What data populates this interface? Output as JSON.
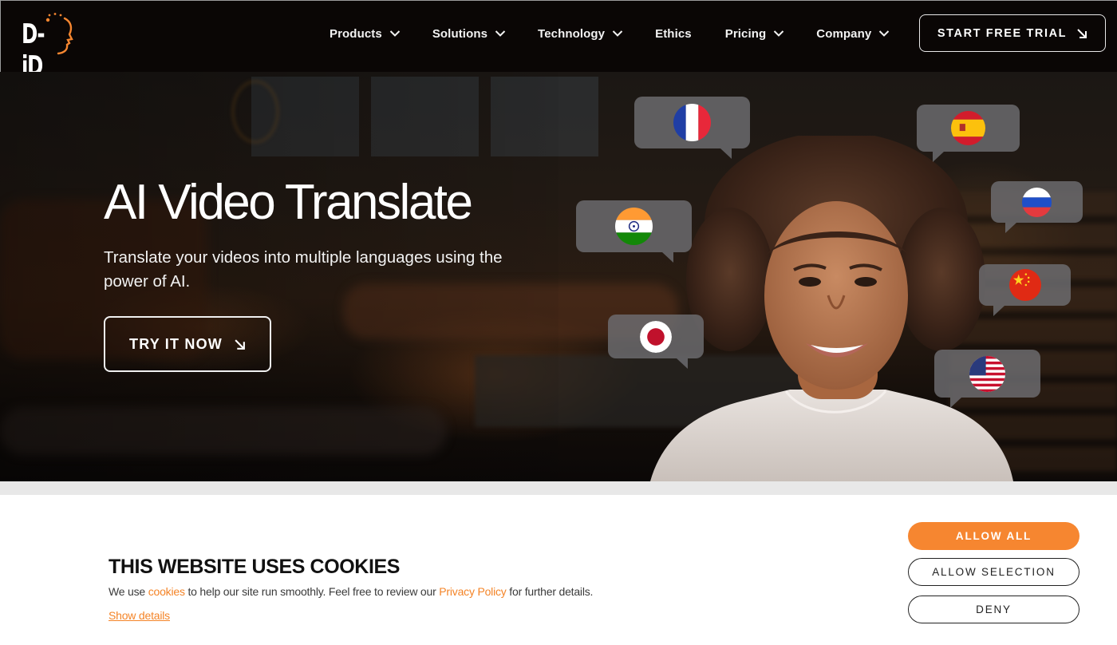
{
  "nav": {
    "logo_text": "D-iD",
    "items": [
      {
        "label": "Products",
        "has_dropdown": true
      },
      {
        "label": "Solutions",
        "has_dropdown": true
      },
      {
        "label": "Technology",
        "has_dropdown": true
      },
      {
        "label": "Ethics",
        "has_dropdown": false
      },
      {
        "label": "Pricing",
        "has_dropdown": true
      },
      {
        "label": "Company",
        "has_dropdown": true
      }
    ],
    "cta_label": "START FREE TRIAL",
    "cta_icon": "arrow-down-right-icon"
  },
  "hero": {
    "title": "AI Video Translate",
    "subtitle": "Translate your videos into multiple languages using the power of AI.",
    "cta_label": "TRY IT NOW",
    "cta_icon": "arrow-down-right-icon",
    "language_bubbles": [
      {
        "language": "French",
        "flag": "france-flag-icon"
      },
      {
        "language": "Hindi",
        "flag": "india-flag-icon"
      },
      {
        "language": "Japanese",
        "flag": "japan-flag-icon"
      },
      {
        "language": "Spanish",
        "flag": "spain-flag-icon"
      },
      {
        "language": "Russian",
        "flag": "russia-flag-icon"
      },
      {
        "language": "Chinese",
        "flag": "china-flag-icon"
      },
      {
        "language": "English",
        "flag": "usa-flag-icon"
      }
    ]
  },
  "cookie_banner": {
    "title": "THIS WEBSITE USES COOKIES",
    "text_before": "We use ",
    "cookies_link": "cookies",
    "text_middle": " to help our site run smoothly. Feel free to review our ",
    "privacy_link": "Privacy Policy",
    "text_after": " for further details.",
    "show_details": "Show details",
    "buttons": {
      "allow_all": "ALLOW ALL",
      "allow_selection": "ALLOW SELECTION",
      "deny": "DENY"
    }
  },
  "colors": {
    "brand_orange": "#f68630",
    "link_orange": "#f48427",
    "nav_bg": "#0a0605",
    "text_dark": "#111111"
  }
}
